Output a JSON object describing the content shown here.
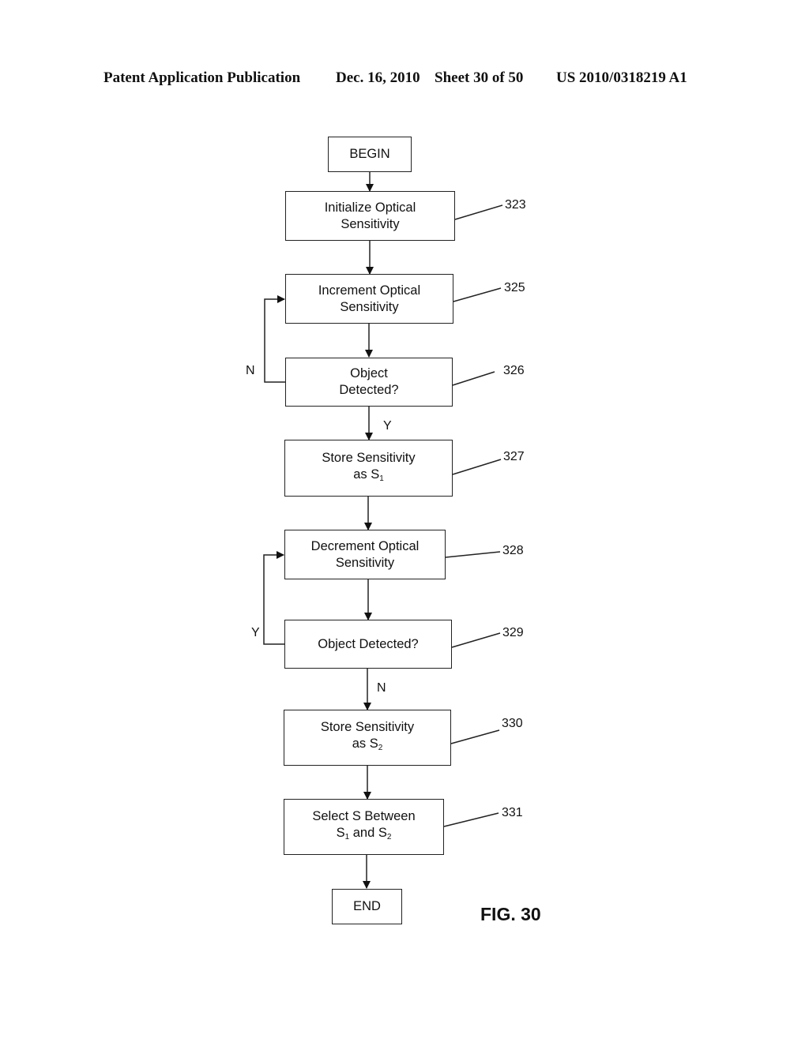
{
  "header": {
    "publication": "Patent Application Publication",
    "date": "Dec. 16, 2010",
    "sheet": "Sheet 30 of 50",
    "number": "US 2010/0318219 A1"
  },
  "flowchart": {
    "nodes": [
      {
        "id": "begin",
        "text": "BEGIN",
        "ref": ""
      },
      {
        "id": "n323",
        "text": "Initialize Optical\nSensitivity",
        "ref": "323"
      },
      {
        "id": "n325",
        "text": "Increment Optical\nSensitivity",
        "ref": "325"
      },
      {
        "id": "n326",
        "text": "Object\nDetected?",
        "ref": "326"
      },
      {
        "id": "n327",
        "text": "Store Sensitivity\nas S",
        "sub": "1",
        "ref": "327"
      },
      {
        "id": "n328",
        "text": "Decrement Optical\nSensitivity",
        "ref": "328"
      },
      {
        "id": "n329",
        "text": "Object Detected?",
        "ref": "329"
      },
      {
        "id": "n330",
        "text": "Store Sensitivity\nas S",
        "sub": "2",
        "ref": "330"
      },
      {
        "id": "n331",
        "line1": "Select S Between",
        "s1": "S",
        "s1sub": "1",
        "mid": " and ",
        "s2": "S",
        "s2sub": "2",
        "ref": "331"
      },
      {
        "id": "end",
        "text": "END",
        "ref": ""
      }
    ],
    "branch_labels": {
      "n326_no": "N",
      "n326_yes": "Y",
      "n329_yes": "Y",
      "n329_no": "N"
    },
    "figure_label": "FIG. 30"
  }
}
